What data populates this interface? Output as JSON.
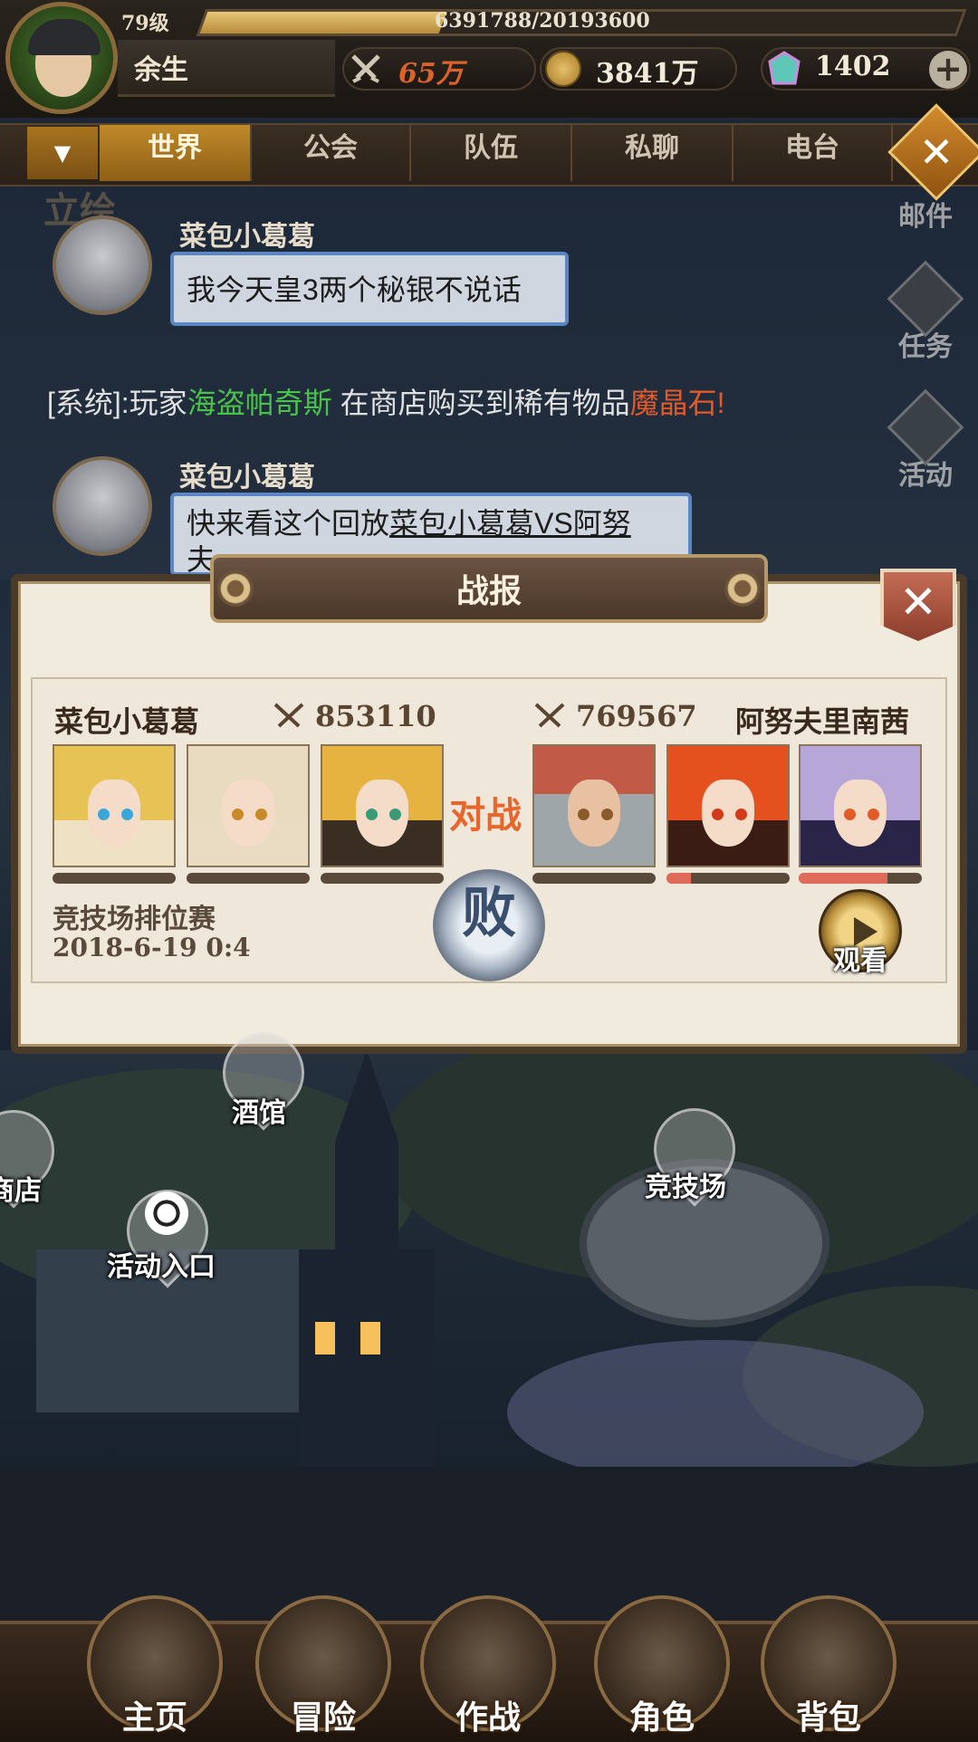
{
  "player": {
    "level": "79级",
    "xp_text": "6391788/20193600",
    "xp_progress": 0.3165,
    "name": "余生"
  },
  "resources": {
    "combat_power": "65万",
    "gold": "3841万",
    "gems": "1402",
    "add_label": "+"
  },
  "chat_tabs": {
    "dropdown": "▼",
    "items": [
      "世界",
      "公会",
      "队伍",
      "私聊",
      "电台"
    ],
    "active": "世界",
    "close": "✕"
  },
  "side_buttons": {
    "mail": "邮件",
    "quest": "任务",
    "event": "活动"
  },
  "chat": {
    "msg1_sender": "菜包小葛葛",
    "msg1_text": "我今天皇3两个秘银不说话",
    "sys_prefix": "[系统]:玩家",
    "sys_player": "海盗帕奇斯",
    "sys_middle": "在商店购买到稀有物品",
    "sys_item": "魔晶石!",
    "msg2_sender": "菜包小葛葛",
    "msg2_text_prefix": "快来看这个回放",
    "msg2_text_link": "菜包小葛葛VS阿努",
    "msg2_text_line2": "夫"
  },
  "bg_text": "立绘",
  "battle_report": {
    "title": "战报",
    "close": "✕",
    "left_player": "菜包小葛葛",
    "left_power": "853110",
    "right_player": "阿努夫里南茜",
    "right_power": "769567",
    "vs_label": "对战",
    "mode": "竞技场排位赛",
    "time": "2018-6-19 0:4",
    "result": "败",
    "watch_label": "观看",
    "left_heroes_hp": [
      0,
      0,
      0
    ],
    "right_heroes_hp": [
      0,
      0.2,
      0.72
    ]
  },
  "map_labels": {
    "tavern": "酒馆",
    "shop": "商店",
    "arena": "竞技场",
    "event_entry": "活动入口"
  },
  "bottom_nav": {
    "home": "主页",
    "adventure": "冒险",
    "battle": "作战",
    "character": "角色",
    "bag": "背包"
  },
  "colors": {
    "accent_gold": "#c08a2a",
    "system_player": "#48c24a",
    "system_item": "#e35a2a",
    "vs": "#e8652c"
  }
}
